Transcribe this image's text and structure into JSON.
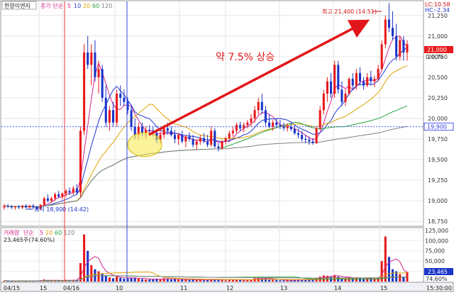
{
  "header": {
    "stock_name": "한양이엔지",
    "ma_label": "종가 단순",
    "ma_periods": [
      "5",
      "10",
      "20",
      "60",
      "120"
    ],
    "lc": "LC:10.58",
    "hc": "HC:-2.34"
  },
  "annotations": {
    "rise_text": "약 7.5% 상승",
    "max_label": "최고 21,400 (14:51)",
    "min_label": "최저 18,900 (14:42)"
  },
  "price_box": {
    "value": "21,000",
    "change": "0.00%",
    "ref_line_label": "19,900"
  },
  "volume_header": {
    "title": "거래량",
    "ma_label": "단순",
    "ma_periods": [
      "5",
      "20",
      "60",
      "120"
    ],
    "current": "23,465주(74.60%)"
  },
  "volume_box": {
    "value": "23,465",
    "pct": "74.60%"
  },
  "colors": {
    "up": "#e8191b",
    "down": "#1a35c8",
    "ma5": "#d4248c",
    "ma10": "#1f36d0",
    "ma20": "#e0a100",
    "ma60": "#27a33c",
    "ma120": "#7f7f7f",
    "ref_line": "#4a5ff0",
    "annotation": "#e2161a"
  },
  "chart_data": {
    "type": "candlestick",
    "price_axis": {
      "ticks": [
        "21,250",
        "21,000",
        "20,750",
        "20,500",
        "20,250",
        "20,000",
        "19,750",
        "19,500",
        "19,250",
        "19,000",
        "18,750"
      ],
      "range": [
        18700,
        21420
      ]
    },
    "volume_axis": {
      "ticks": [
        "125,000",
        "100,000",
        "75,000",
        "50,000",
        "25,000"
      ],
      "range": [
        0,
        130000
      ]
    },
    "x_ticks": [
      "04/15",
      "15",
      "04/16",
      "10",
      "11",
      "12",
      "13",
      "14",
      "15",
      "15:30:00"
    ],
    "reference_price": 19900,
    "max_price": 21400,
    "min_price": 18900,
    "candles": [
      {
        "o": 18920,
        "h": 18960,
        "l": 18890,
        "c": 18940,
        "v": 2000
      },
      {
        "o": 18940,
        "h": 18960,
        "l": 18910,
        "c": 18930,
        "v": 1500
      },
      {
        "o": 18930,
        "h": 18950,
        "l": 18900,
        "c": 18920,
        "v": 1200
      },
      {
        "o": 18920,
        "h": 18940,
        "l": 18890,
        "c": 18930,
        "v": 1500
      },
      {
        "o": 18930,
        "h": 18950,
        "l": 18900,
        "c": 18920,
        "v": 1400
      },
      {
        "o": 18920,
        "h": 18950,
        "l": 18900,
        "c": 18940,
        "v": 1600
      },
      {
        "o": 18940,
        "h": 18960,
        "l": 18910,
        "c": 18920,
        "v": 1300
      },
      {
        "o": 18920,
        "h": 18950,
        "l": 18900,
        "c": 18940,
        "v": 1700
      },
      {
        "o": 18940,
        "h": 18960,
        "l": 18900,
        "c": 18920,
        "v": 1500
      },
      {
        "o": 18920,
        "h": 18940,
        "l": 18890,
        "c": 18900,
        "v": 2500
      },
      {
        "o": 18900,
        "h": 18960,
        "l": 18890,
        "c": 18950,
        "v": 3000
      },
      {
        "o": 18950,
        "h": 19050,
        "l": 18940,
        "c": 19030,
        "v": 5000
      },
      {
        "o": 19030,
        "h": 19080,
        "l": 18980,
        "c": 19000,
        "v": 3000
      },
      {
        "o": 19000,
        "h": 19050,
        "l": 18980,
        "c": 19030,
        "v": 2000
      },
      {
        "o": 19030,
        "h": 19100,
        "l": 19000,
        "c": 19080,
        "v": 3000
      },
      {
        "o": 19080,
        "h": 19120,
        "l": 19030,
        "c": 19050,
        "v": 2500
      },
      {
        "o": 19050,
        "h": 19100,
        "l": 19020,
        "c": 19090,
        "v": 2500
      },
      {
        "o": 19090,
        "h": 19140,
        "l": 19050,
        "c": 19120,
        "v": 4000
      },
      {
        "o": 19120,
        "h": 19160,
        "l": 19070,
        "c": 19100,
        "v": 3000
      },
      {
        "o": 19100,
        "h": 19180,
        "l": 19070,
        "c": 19150,
        "v": 4000
      },
      {
        "o": 19150,
        "h": 19200,
        "l": 19080,
        "c": 19100,
        "v": 3500
      },
      {
        "o": 19100,
        "h": 19900,
        "l": 19050,
        "c": 19850,
        "v": 45000
      },
      {
        "o": 19850,
        "h": 20900,
        "l": 19800,
        "c": 20800,
        "v": 115000
      },
      {
        "o": 20800,
        "h": 21000,
        "l": 20600,
        "c": 20650,
        "v": 75000
      },
      {
        "o": 20650,
        "h": 20900,
        "l": 20400,
        "c": 20800,
        "v": 40000
      },
      {
        "o": 20800,
        "h": 20950,
        "l": 20450,
        "c": 20500,
        "v": 30000
      },
      {
        "o": 20500,
        "h": 20700,
        "l": 20300,
        "c": 20600,
        "v": 25000
      },
      {
        "o": 20600,
        "h": 20650,
        "l": 20200,
        "c": 20250,
        "v": 20000
      },
      {
        "o": 20250,
        "h": 20400,
        "l": 19900,
        "c": 19950,
        "v": 15000
      },
      {
        "o": 19950,
        "h": 20150,
        "l": 19850,
        "c": 20100,
        "v": 10000
      },
      {
        "o": 20100,
        "h": 20200,
        "l": 19900,
        "c": 19950,
        "v": 8000
      },
      {
        "o": 19950,
        "h": 20350,
        "l": 19900,
        "c": 20300,
        "v": 12000
      },
      {
        "o": 20300,
        "h": 20400,
        "l": 20150,
        "c": 20250,
        "v": 9000
      },
      {
        "o": 20250,
        "h": 20350,
        "l": 20150,
        "c": 20200,
        "v": 7000
      },
      {
        "o": 20200,
        "h": 20250,
        "l": 20050,
        "c": 20100,
        "v": 8000
      },
      {
        "o": 20100,
        "h": 20150,
        "l": 19850,
        "c": 19900,
        "v": 9000
      },
      {
        "o": 19900,
        "h": 20000,
        "l": 19750,
        "c": 19800,
        "v": 10000
      },
      {
        "o": 19800,
        "h": 19950,
        "l": 19750,
        "c": 19900,
        "v": 7000
      },
      {
        "o": 19900,
        "h": 19950,
        "l": 19780,
        "c": 19820,
        "v": 6000
      },
      {
        "o": 19820,
        "h": 19900,
        "l": 19760,
        "c": 19860,
        "v": 5000
      },
      {
        "o": 19860,
        "h": 19920,
        "l": 19800,
        "c": 19850,
        "v": 5000
      },
      {
        "o": 19850,
        "h": 19900,
        "l": 19780,
        "c": 19820,
        "v": 6000
      },
      {
        "o": 19820,
        "h": 19870,
        "l": 19700,
        "c": 19740,
        "v": 7000
      },
      {
        "o": 19740,
        "h": 19850,
        "l": 19700,
        "c": 19800,
        "v": 6000
      },
      {
        "o": 19800,
        "h": 19920,
        "l": 19760,
        "c": 19880,
        "v": 8000
      },
      {
        "o": 19880,
        "h": 19950,
        "l": 19800,
        "c": 19850,
        "v": 7000
      },
      {
        "o": 19850,
        "h": 19900,
        "l": 19780,
        "c": 19800,
        "v": 5000
      },
      {
        "o": 19800,
        "h": 19860,
        "l": 19700,
        "c": 19750,
        "v": 6000
      },
      {
        "o": 19750,
        "h": 19820,
        "l": 19680,
        "c": 19800,
        "v": 5000
      },
      {
        "o": 19800,
        "h": 19850,
        "l": 19700,
        "c": 19720,
        "v": 6000
      },
      {
        "o": 19720,
        "h": 19800,
        "l": 19650,
        "c": 19780,
        "v": 5000
      },
      {
        "o": 19780,
        "h": 19830,
        "l": 19720,
        "c": 19750,
        "v": 4000
      },
      {
        "o": 19750,
        "h": 19800,
        "l": 19650,
        "c": 19680,
        "v": 5000
      },
      {
        "o": 19680,
        "h": 19750,
        "l": 19620,
        "c": 19720,
        "v": 4000
      },
      {
        "o": 19720,
        "h": 19800,
        "l": 19680,
        "c": 19760,
        "v": 4000
      },
      {
        "o": 19760,
        "h": 19820,
        "l": 19700,
        "c": 19720,
        "v": 3000
      },
      {
        "o": 19720,
        "h": 19800,
        "l": 19650,
        "c": 19680,
        "v": 4000
      },
      {
        "o": 19680,
        "h": 19900,
        "l": 19660,
        "c": 19850,
        "v": 6000
      },
      {
        "o": 19850,
        "h": 19880,
        "l": 19640,
        "c": 19660,
        "v": 5000
      },
      {
        "o": 19660,
        "h": 19700,
        "l": 19600,
        "c": 19640,
        "v": 6000
      },
      {
        "o": 19640,
        "h": 19740,
        "l": 19620,
        "c": 19720,
        "v": 4000
      },
      {
        "o": 19720,
        "h": 19780,
        "l": 19680,
        "c": 19760,
        "v": 3000
      },
      {
        "o": 19760,
        "h": 19850,
        "l": 19740,
        "c": 19820,
        "v": 5000
      },
      {
        "o": 19820,
        "h": 19900,
        "l": 19780,
        "c": 19850,
        "v": 4000
      },
      {
        "o": 19850,
        "h": 19950,
        "l": 19820,
        "c": 19920,
        "v": 5000
      },
      {
        "o": 19920,
        "h": 19960,
        "l": 19850,
        "c": 19880,
        "v": 4000
      },
      {
        "o": 19880,
        "h": 19950,
        "l": 19830,
        "c": 19920,
        "v": 4000
      },
      {
        "o": 19920,
        "h": 19980,
        "l": 19880,
        "c": 19950,
        "v": 4000
      },
      {
        "o": 19950,
        "h": 20050,
        "l": 19900,
        "c": 20000,
        "v": 5000
      },
      {
        "o": 20000,
        "h": 20150,
        "l": 19950,
        "c": 20100,
        "v": 8000
      },
      {
        "o": 20100,
        "h": 20250,
        "l": 20050,
        "c": 20200,
        "v": 10000
      },
      {
        "o": 20200,
        "h": 20300,
        "l": 20050,
        "c": 20100,
        "v": 8000
      },
      {
        "o": 20100,
        "h": 20150,
        "l": 19900,
        "c": 19950,
        "v": 7000
      },
      {
        "o": 19950,
        "h": 20050,
        "l": 19880,
        "c": 19900,
        "v": 5000
      },
      {
        "o": 19900,
        "h": 19980,
        "l": 19850,
        "c": 19950,
        "v": 4000
      },
      {
        "o": 19950,
        "h": 20000,
        "l": 19880,
        "c": 19920,
        "v": 4000
      },
      {
        "o": 19920,
        "h": 19980,
        "l": 19870,
        "c": 19900,
        "v": 3000
      },
      {
        "o": 19900,
        "h": 19950,
        "l": 19850,
        "c": 19880,
        "v": 3000
      },
      {
        "o": 19880,
        "h": 19940,
        "l": 19840,
        "c": 19900,
        "v": 3000
      },
      {
        "o": 19900,
        "h": 19950,
        "l": 19850,
        "c": 19870,
        "v": 3000
      },
      {
        "o": 19870,
        "h": 19920,
        "l": 19800,
        "c": 19820,
        "v": 4000
      },
      {
        "o": 19820,
        "h": 19870,
        "l": 19760,
        "c": 19800,
        "v": 4000
      },
      {
        "o": 19800,
        "h": 19850,
        "l": 19720,
        "c": 19750,
        "v": 5000
      },
      {
        "o": 19750,
        "h": 19800,
        "l": 19700,
        "c": 19740,
        "v": 4000
      },
      {
        "o": 19740,
        "h": 19780,
        "l": 19680,
        "c": 19720,
        "v": 5000
      },
      {
        "o": 19720,
        "h": 19760,
        "l": 19680,
        "c": 19700,
        "v": 5000
      },
      {
        "o": 19700,
        "h": 19900,
        "l": 19690,
        "c": 19880,
        "v": 8000
      },
      {
        "o": 19880,
        "h": 20150,
        "l": 19860,
        "c": 20100,
        "v": 12000
      },
      {
        "o": 20100,
        "h": 20350,
        "l": 20050,
        "c": 20300,
        "v": 15000
      },
      {
        "o": 20300,
        "h": 20500,
        "l": 20200,
        "c": 20450,
        "v": 14000
      },
      {
        "o": 20450,
        "h": 20550,
        "l": 20250,
        "c": 20300,
        "v": 12000
      },
      {
        "o": 20300,
        "h": 20700,
        "l": 20250,
        "c": 20650,
        "v": 16000
      },
      {
        "o": 20650,
        "h": 20700,
        "l": 20300,
        "c": 20350,
        "v": 12000
      },
      {
        "o": 20350,
        "h": 20450,
        "l": 20150,
        "c": 20200,
        "v": 9000
      },
      {
        "o": 20200,
        "h": 20350,
        "l": 20150,
        "c": 20300,
        "v": 8000
      },
      {
        "o": 20300,
        "h": 20500,
        "l": 20280,
        "c": 20480,
        "v": 10000
      },
      {
        "o": 20480,
        "h": 20550,
        "l": 20350,
        "c": 20400,
        "v": 8000
      },
      {
        "o": 20400,
        "h": 20600,
        "l": 20350,
        "c": 20550,
        "v": 10000
      },
      {
        "o": 20550,
        "h": 20620,
        "l": 20400,
        "c": 20450,
        "v": 8000
      },
      {
        "o": 20450,
        "h": 20500,
        "l": 20350,
        "c": 20400,
        "v": 6000
      },
      {
        "o": 20400,
        "h": 20550,
        "l": 20380,
        "c": 20500,
        "v": 7000
      },
      {
        "o": 20500,
        "h": 20580,
        "l": 20400,
        "c": 20450,
        "v": 6000
      },
      {
        "o": 20450,
        "h": 20520,
        "l": 20380,
        "c": 20480,
        "v": 6000
      },
      {
        "o": 20480,
        "h": 20650,
        "l": 20450,
        "c": 20600,
        "v": 9000
      },
      {
        "o": 20600,
        "h": 20950,
        "l": 20580,
        "c": 20900,
        "v": 50000
      },
      {
        "o": 20900,
        "h": 21250,
        "l": 20850,
        "c": 21200,
        "v": 110000
      },
      {
        "o": 21200,
        "h": 21400,
        "l": 21050,
        "c": 21100,
        "v": 60000
      },
      {
        "o": 21100,
        "h": 21300,
        "l": 20950,
        "c": 21000,
        "v": 30000
      },
      {
        "o": 21000,
        "h": 21150,
        "l": 20700,
        "c": 20750,
        "v": 25000
      },
      {
        "o": 20750,
        "h": 21000,
        "l": 20700,
        "c": 20950,
        "v": 18000
      },
      {
        "o": 20950,
        "h": 21000,
        "l": 20700,
        "c": 20800,
        "v": 12000
      },
      {
        "o": 20800,
        "h": 20950,
        "l": 20700,
        "c": 20900,
        "v": 23465
      }
    ]
  }
}
